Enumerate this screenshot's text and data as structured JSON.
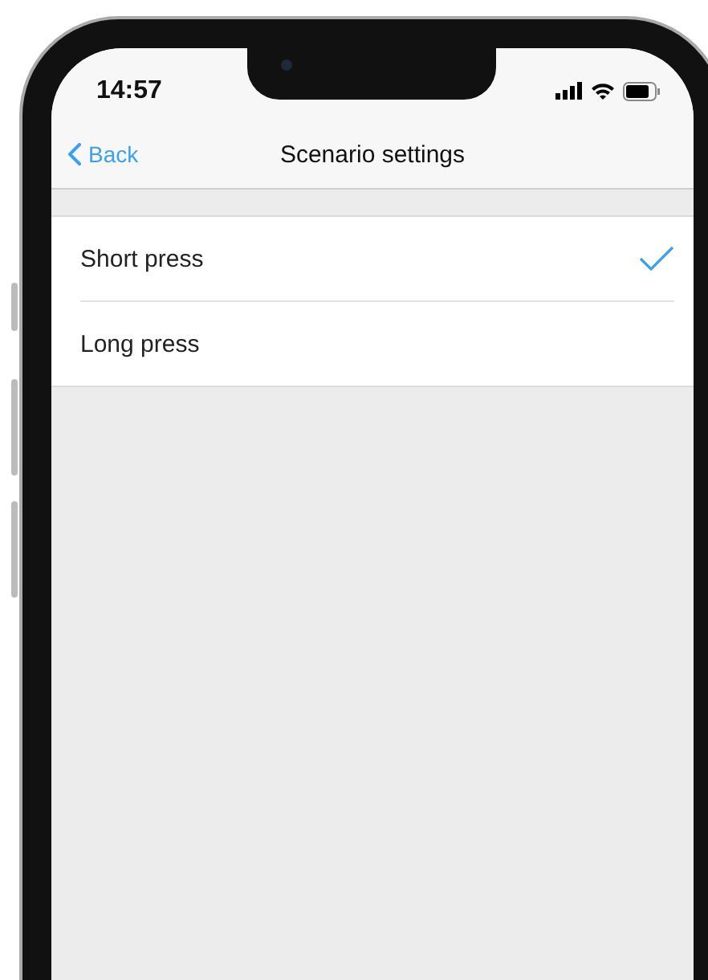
{
  "status_bar": {
    "time": "14:57"
  },
  "nav": {
    "back": "Back",
    "title": "Scenario settings"
  },
  "options": [
    {
      "label": "Short press",
      "selected": true
    },
    {
      "label": "Long press",
      "selected": false
    }
  ]
}
